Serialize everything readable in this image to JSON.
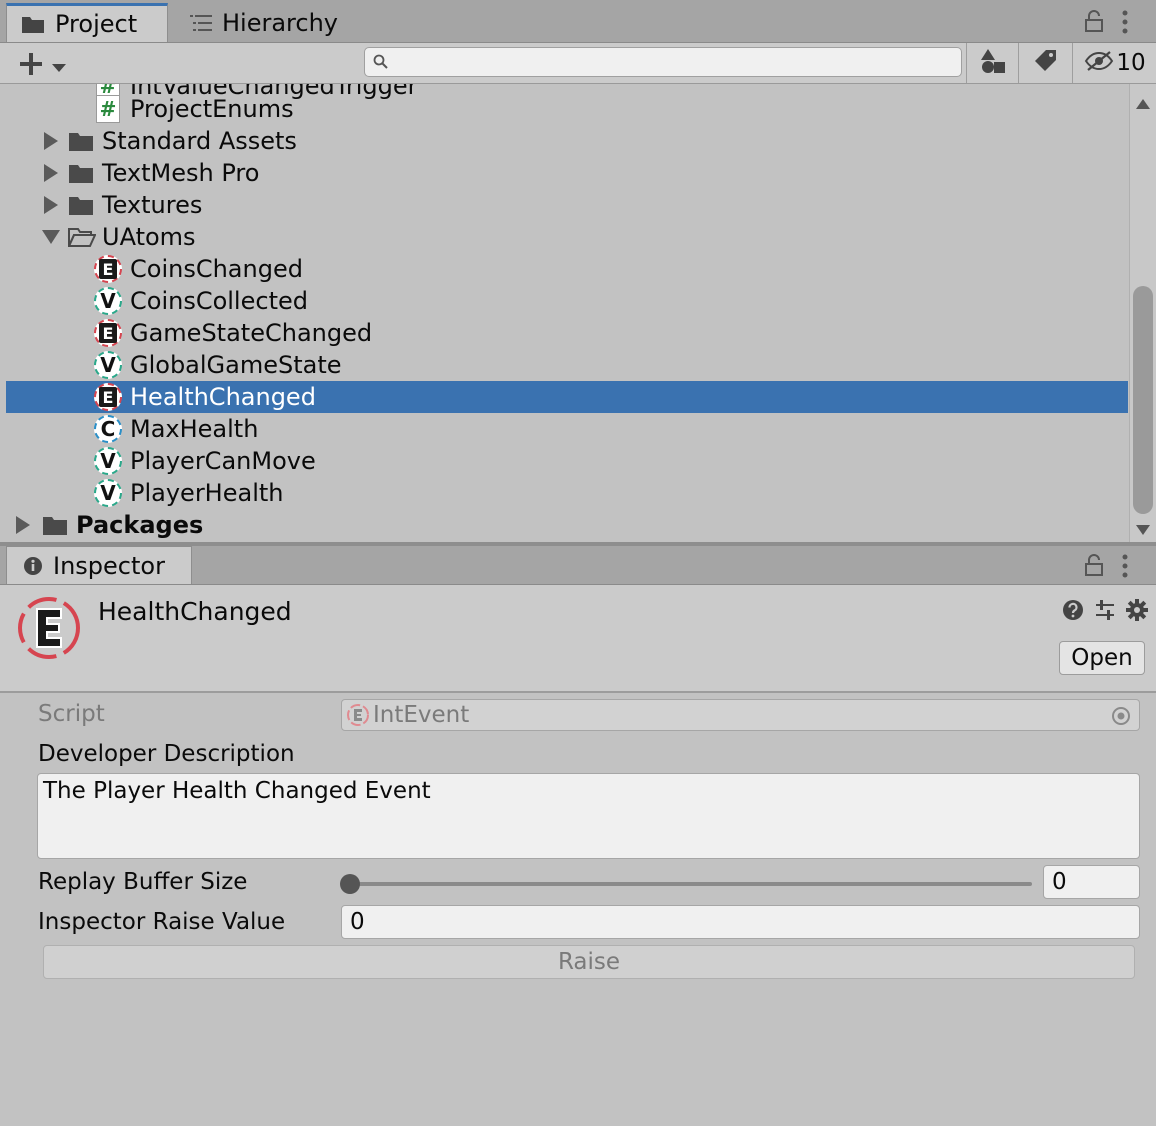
{
  "project_panel": {
    "tabs": {
      "project": "Project",
      "hierarchy": "Hierarchy"
    },
    "hidden_count": "10",
    "partial_item": "IntValueChangedTrigger",
    "items": [
      {
        "label": "ProjectEnums",
        "icon": "script-icon"
      },
      {
        "label": "Standard Assets",
        "icon": "folder-icon"
      },
      {
        "label": "TextMesh Pro",
        "icon": "folder-icon"
      },
      {
        "label": "Textures",
        "icon": "folder-icon"
      },
      {
        "label": "UAtoms",
        "icon": "folder-open-icon"
      },
      {
        "label": "CoinsChanged",
        "icon": "event-icon"
      },
      {
        "label": "CoinsCollected",
        "icon": "variable-icon"
      },
      {
        "label": "GameStateChanged",
        "icon": "event-icon"
      },
      {
        "label": "GlobalGameState",
        "icon": "variable-icon"
      },
      {
        "label": "HealthChanged",
        "icon": "event-icon",
        "selected": true
      },
      {
        "label": "MaxHealth",
        "icon": "constant-icon"
      },
      {
        "label": "PlayerCanMove",
        "icon": "variable-icon"
      },
      {
        "label": "PlayerHealth",
        "icon": "variable-icon"
      },
      {
        "label": "Packages",
        "icon": "folder-icon"
      }
    ],
    "icon_letters": {
      "event": "E",
      "variable": "V",
      "constant": "C",
      "script": "#"
    }
  },
  "inspector": {
    "tab": "Inspector",
    "asset_name": "HealthChanged",
    "open_button": "Open",
    "fields": {
      "script_label": "Script",
      "script_value": "IntEvent",
      "description_label": "Developer Description",
      "description_value": "The Player Health Changed Event",
      "replay_label": "Replay Buffer Size",
      "replay_value": "0",
      "raise_value_label": "Inspector Raise Value",
      "raise_value": "0"
    },
    "raise_button": "Raise"
  },
  "colors": {
    "selection": "#3a72b0",
    "event_ring": "#d64550",
    "variable_ring": "#2aa88a",
    "constant_ring": "#2a8fc8"
  }
}
